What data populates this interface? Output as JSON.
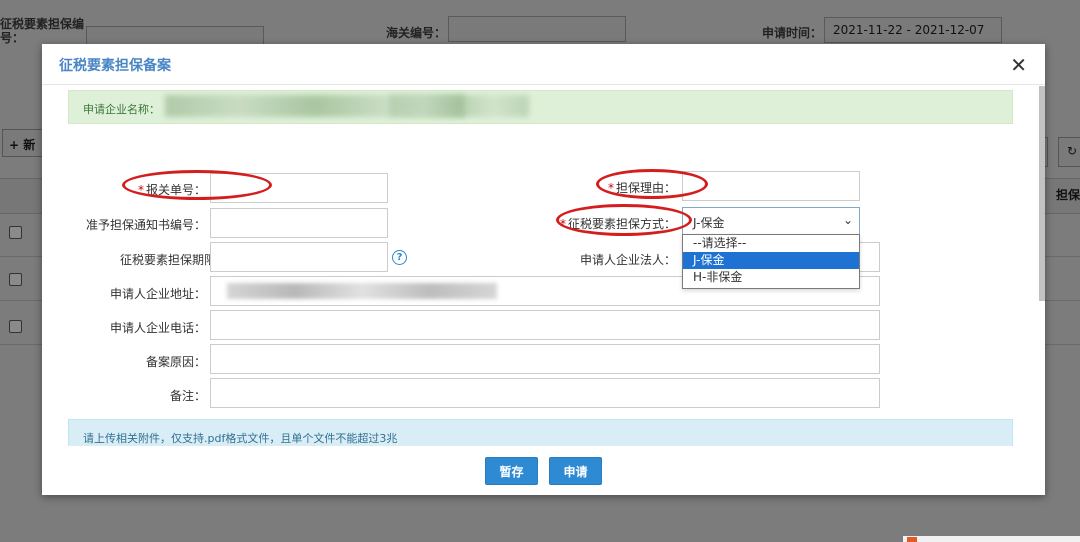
{
  "background": {
    "filter_label_declaration": "征税要素担保编号：",
    "filter_label_customs": "海关编号：",
    "filter_label_apply_time": "申请时间：",
    "apply_time_value": "2021-11-22 - 2021-12-07",
    "add_button": "+ 新",
    "refresh_icon": "refresh-icon",
    "column_header_guarantee": "担保"
  },
  "modal": {
    "title": "征税要素担保备案",
    "close_icon": "close-icon",
    "company_name_label": "申请企业名称：",
    "fields": {
      "declaration_no": "报关单号：",
      "guarantee_reason": "担保理由：",
      "approval_notice_no": "准予担保通知书编号：",
      "guarantee_method": "征税要素担保方式：",
      "guarantee_period": "征税要素担保期限：",
      "legal_person": "申请人企业法人：",
      "company_address": "申请人企业地址：",
      "company_phone": "申请人企业电话：",
      "filing_reason": "备案原因：",
      "remarks": "备注："
    },
    "required_mark": "*",
    "guarantee_method_value": "J-保金",
    "guarantee_method_options": [
      "--请选择--",
      "J-保金",
      "H-非保金"
    ],
    "selected_option_index": 1,
    "help_icon": "question-circle-icon",
    "help_icon_glyph": "?",
    "upload_notice": "请上传相关附件，仅支持.pdf格式文件，且单个文件不能超过3兆",
    "buttons": {
      "save_draft": "暂存",
      "apply": "申请"
    }
  },
  "annotations": {
    "color": "#d41d1d",
    "circled_fields": [
      "报关单号",
      "担保理由",
      "征税要素担保方式"
    ]
  }
}
